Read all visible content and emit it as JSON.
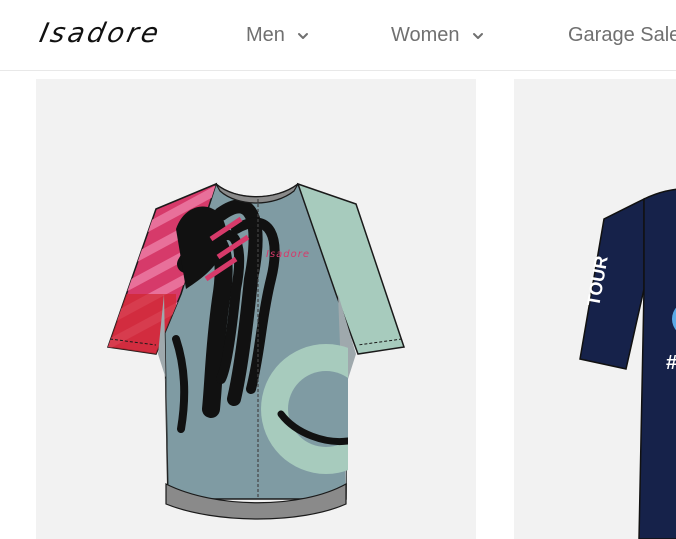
{
  "brand": {
    "logo_text": "Isadore"
  },
  "nav": {
    "items": [
      {
        "label": "Men",
        "has_dropdown": true
      },
      {
        "label": "Women",
        "has_dropdown": true
      },
      {
        "label": "Garage Sale",
        "has_dropdown": false
      }
    ]
  },
  "products": [
    {
      "print_text": "Isadore",
      "colors": {
        "body": "#7f9ba3",
        "sleeve_right": "#a7cbbd",
        "sleeve_left": "#d63a6a",
        "stripes": "#111111"
      }
    },
    {
      "print_text": "TOUR",
      "colors": {
        "body": "#16224a"
      }
    }
  ]
}
